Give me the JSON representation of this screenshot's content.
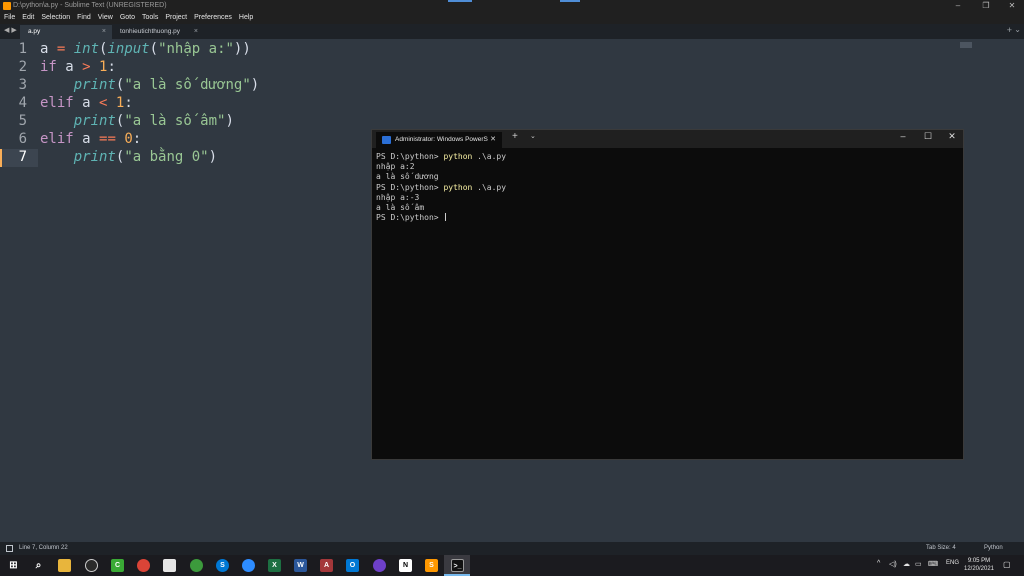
{
  "window": {
    "title": "D:\\python\\a.py - Sublime Text (UNREGISTERED)"
  },
  "menu": [
    "File",
    "Edit",
    "Selection",
    "Find",
    "View",
    "Goto",
    "Tools",
    "Project",
    "Preferences",
    "Help"
  ],
  "tabs": [
    {
      "label": "a.py",
      "active": true
    },
    {
      "label": "tonhieutichthuong.py",
      "active": false
    }
  ],
  "editor": {
    "line_numbers": [
      "1",
      "2",
      "3",
      "4",
      "5",
      "6",
      "7"
    ],
    "current_line": 7
  },
  "statusbar": {
    "position": "Line 7, Column 22",
    "tab_size": "Tab Size: 4",
    "syntax": "Python"
  },
  "terminal": {
    "tab_title": "Administrator: Windows PowerS",
    "lines": [
      {
        "prompt": "PS D:\\python> ",
        "cmd": "python",
        "rest": " .\\a.py"
      },
      {
        "text": "nhập a:2"
      },
      {
        "text": "a là số dương"
      },
      {
        "prompt": "PS D:\\python> ",
        "cmd": "python",
        "rest": " .\\a.py"
      },
      {
        "text": "nhập a:-3"
      },
      {
        "text": "a là số âm"
      },
      {
        "prompt": "PS D:\\python> "
      }
    ]
  },
  "taskbar": {
    "input_lang": "ENG",
    "time": "9:05 PM",
    "date": "12/20/2021"
  },
  "colors": {
    "editor_bg": "#303841",
    "keyword": "#c695c6",
    "function": "#5fb4b4",
    "string": "#99c794",
    "number": "#f9ae58",
    "operator": "#f97b58",
    "terminal_bg": "#0c0c0c",
    "terminal_command": "#f9f1a5"
  }
}
